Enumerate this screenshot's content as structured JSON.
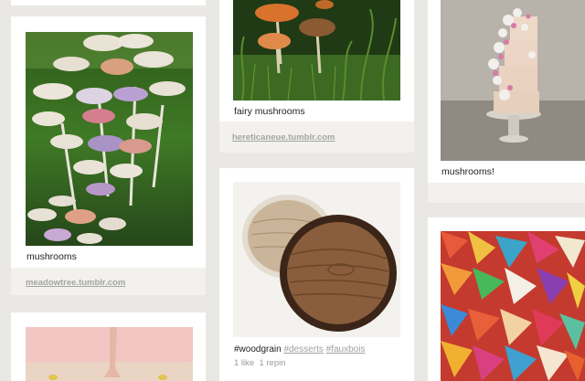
{
  "pins": [
    {
      "caption": "mushrooms",
      "source": "meadowtree.tumblr.com"
    },
    {
      "caption": "fairy mushrooms",
      "source": "hereticaneue.tumblr.com"
    },
    {
      "caption": "mushrooms!"
    },
    {
      "tags": [
        "#woodgrain",
        "#desserts",
        "#fauxbois"
      ],
      "stats": "1 like  1 repin"
    }
  ],
  "colors": {
    "background": "#e9e8e4",
    "card": "#ffffff",
    "source_link": "#a4a4a4"
  }
}
